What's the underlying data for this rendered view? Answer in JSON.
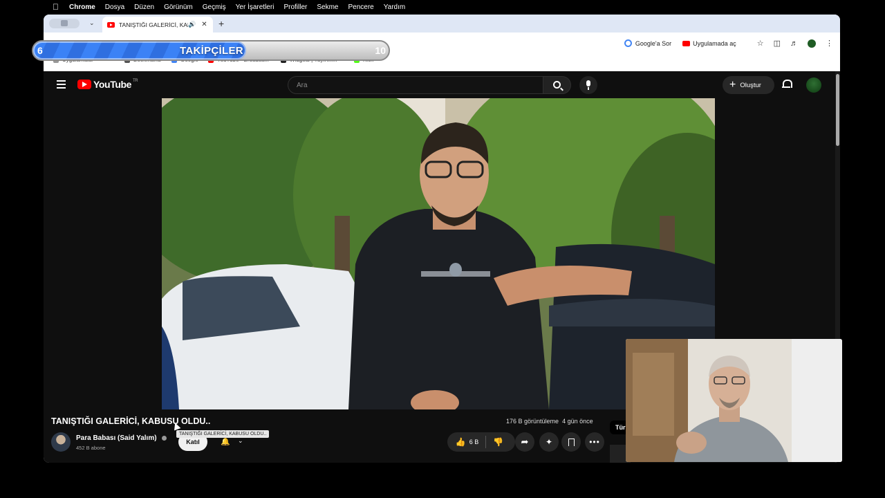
{
  "macos_menubar": {
    "app": "Chrome",
    "items": [
      "Dosya",
      "Düzen",
      "Görünüm",
      "Geçmiş",
      "Yer İşaretleri",
      "Profiller",
      "Sekme",
      "Pencere",
      "Yardım"
    ]
  },
  "browser": {
    "tab_title": "TANIŞTIĞI GALERİCİ, KAB",
    "toolbar": {
      "google_chip": "Google'a Sor",
      "app_chip": "Uygulamada aç"
    },
    "bookmarks": [
      "Uygulamalar",
      "Bookmarks",
      "Google",
      "YouTube - Broadca...",
      "Widgets | Yayının...",
      "Kick"
    ]
  },
  "overlay": {
    "label": "TAKİPÇİLER",
    "current": "6",
    "goal": "10",
    "progress": 0.6
  },
  "youtube": {
    "logo_text": "YouTube",
    "region": "TR",
    "search_placeholder": "Ara",
    "create_label": "Oluştur",
    "video": {
      "title": "TANIŞTIĞI GALERİCİ, KABUSU OLDU..",
      "views": "176 B görüntüleme",
      "age": "4 gün önce",
      "tooltip": "TANIŞTIĞI GALERİCİ, KABUSU OLDU..",
      "likes": "6 B"
    },
    "channel": {
      "name": "Para Babası (Said Yalım)",
      "subscribers": "452 B abone",
      "join_label": "Katıl"
    },
    "side_chip": "Tür"
  }
}
